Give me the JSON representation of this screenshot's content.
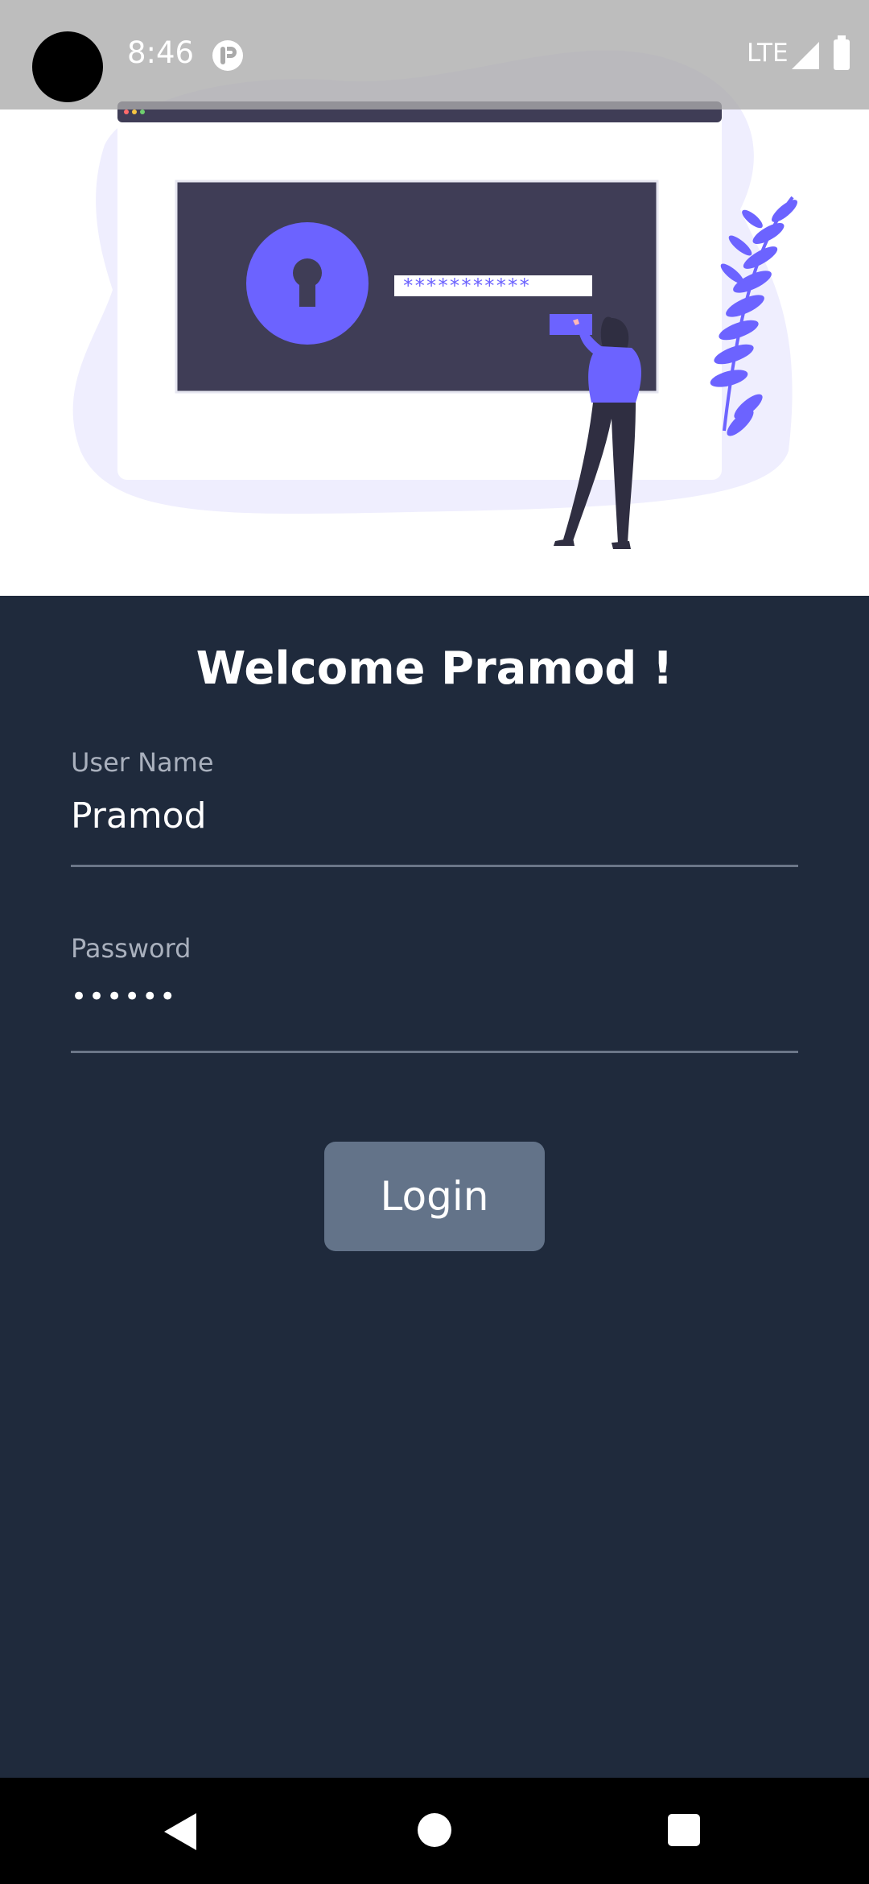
{
  "status_bar": {
    "time": "8:46",
    "network": "LTE"
  },
  "hero": {
    "password_mask": "***********",
    "accent_color": "#6c63ff",
    "screen_color": "#3f3d56"
  },
  "form": {
    "welcome_title": "Welcome Pramod !",
    "username": {
      "label": "User Name",
      "value": "Pramod"
    },
    "password": {
      "label": "Password",
      "value": "••••••"
    },
    "login_label": "Login"
  },
  "colors": {
    "background": "#1f2a3c",
    "button": "#637389",
    "underline": "#6b7688"
  },
  "nav_bar": {
    "icons": [
      "back-icon",
      "home-icon",
      "recents-icon"
    ]
  }
}
